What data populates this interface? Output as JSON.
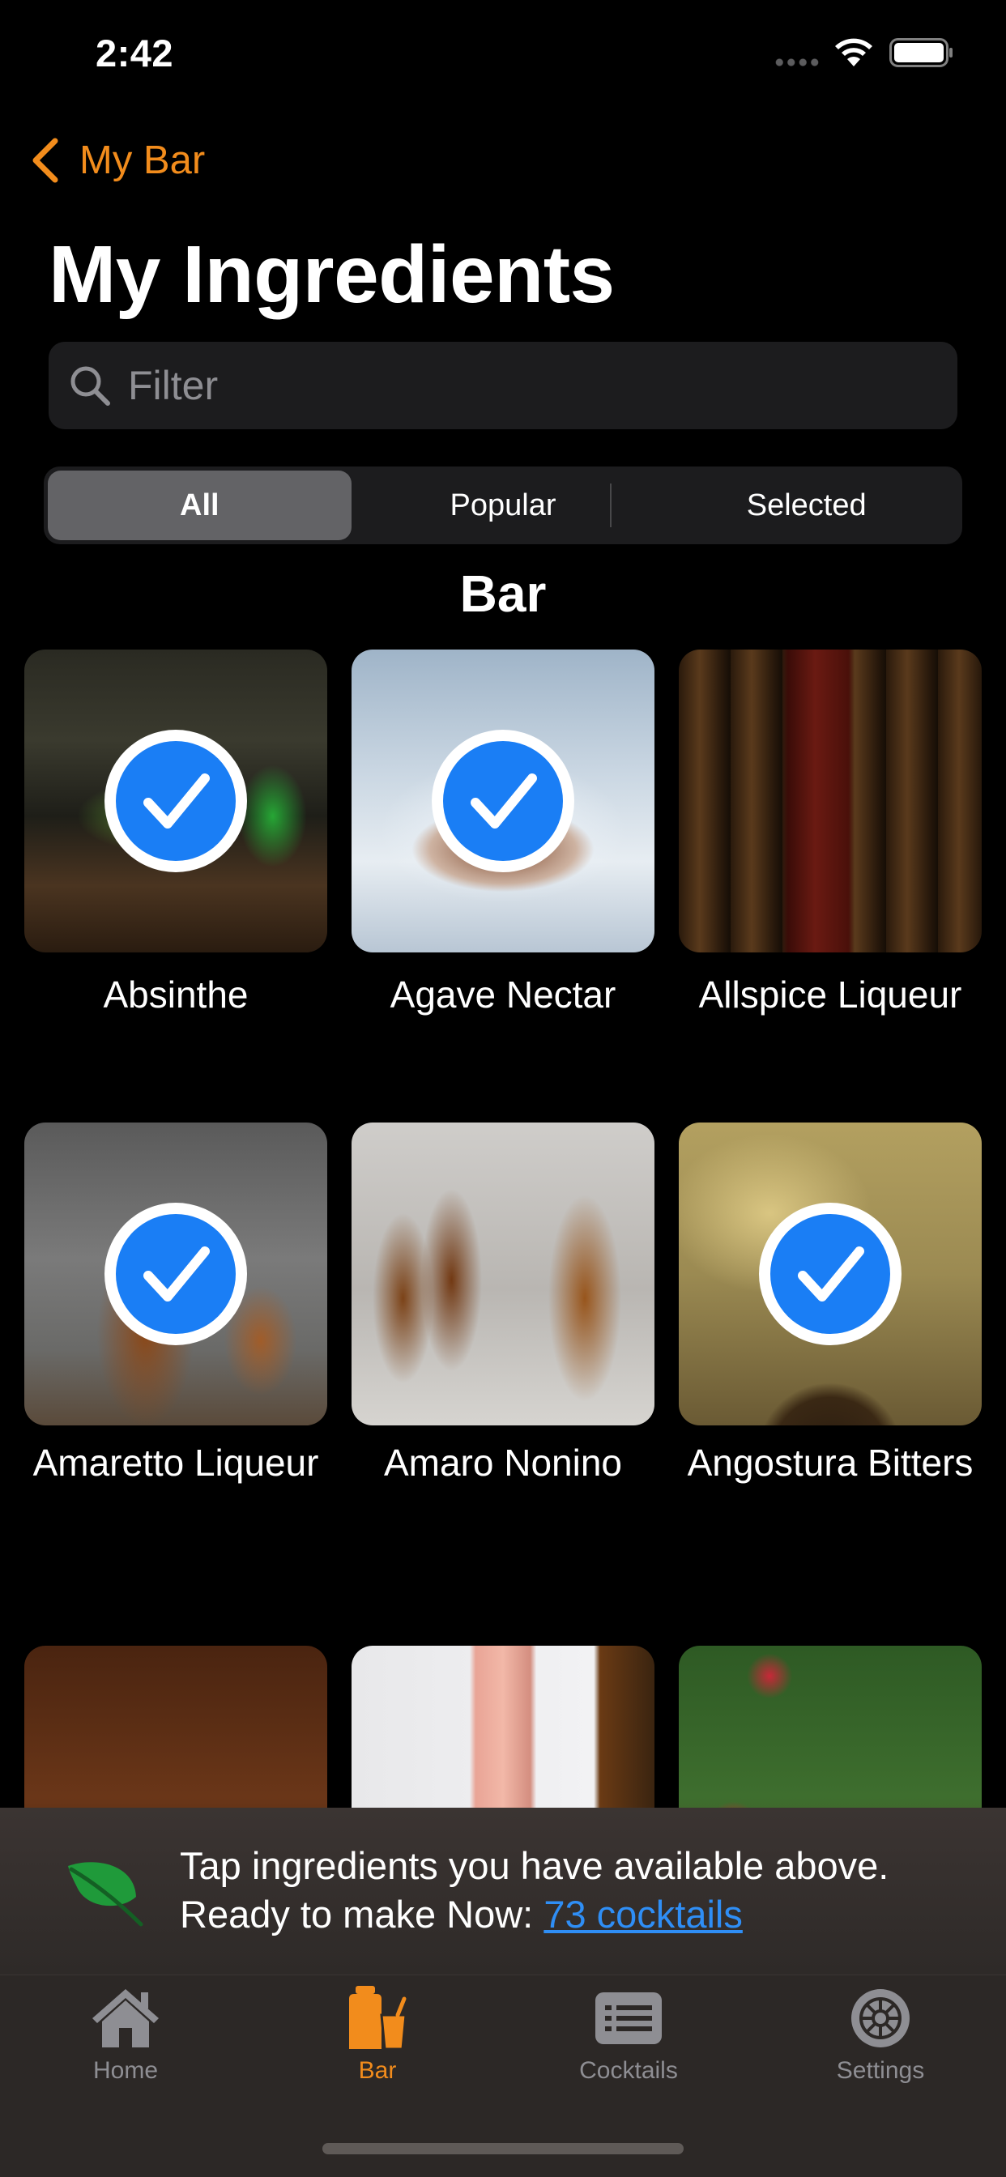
{
  "status_bar": {
    "time": "2:42"
  },
  "nav": {
    "back_label": "My Bar",
    "title": "My Ingredients"
  },
  "search": {
    "placeholder": "Filter",
    "value": ""
  },
  "segments": [
    {
      "label": "All",
      "selected": true
    },
    {
      "label": "Popular",
      "selected": false
    },
    {
      "label": "Selected",
      "selected": false
    }
  ],
  "section": {
    "title": "Bar"
  },
  "ingredients": [
    {
      "name": "Absinthe",
      "selected": true
    },
    {
      "name": "Agave Nectar",
      "selected": true
    },
    {
      "name": "Allspice Liqueur",
      "selected": false
    },
    {
      "name": "Amaretto Liqueur",
      "selected": true
    },
    {
      "name": "Amaro Nonino",
      "selected": false
    },
    {
      "name": "Angostura Bitters",
      "selected": true
    }
  ],
  "info_banner": {
    "line1": "Tap ingredients you have available above.",
    "line2_prefix": "Ready to make Now: ",
    "link_text": "73 cocktails"
  },
  "tabs": [
    {
      "label": "Home",
      "icon": "home-icon",
      "active": false
    },
    {
      "label": "Bar",
      "icon": "bar-icon",
      "active": true
    },
    {
      "label": "Cocktails",
      "icon": "cocktails-icon",
      "active": false
    },
    {
      "label": "Settings",
      "icon": "settings-icon",
      "active": false
    }
  ],
  "colors": {
    "accent": "#f28c1c",
    "link": "#2f8ef5",
    "check": "#1a7ef5"
  }
}
